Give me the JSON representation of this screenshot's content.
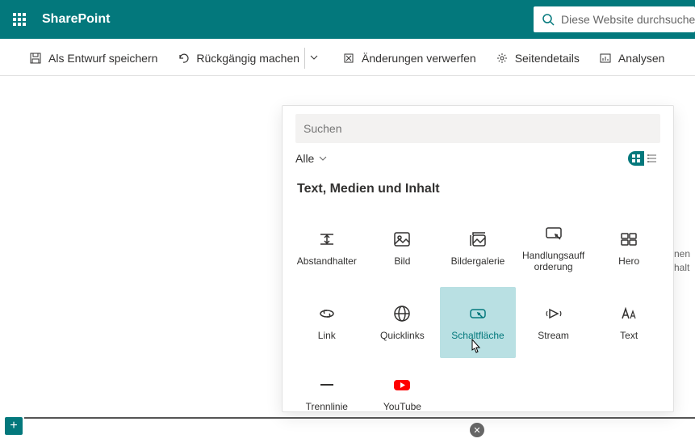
{
  "header": {
    "brand": "SharePoint",
    "search_placeholder": "Diese Website durchsuchen"
  },
  "commands": {
    "save_draft": "Als Entwurf speichern",
    "undo": "Rückgängig machen",
    "discard": "Änderungen verwerfen",
    "details": "Seitendetails",
    "analytics": "Analysen"
  },
  "panel": {
    "search_placeholder": "Suchen",
    "filter_label": "Alle",
    "section_title": "Text, Medien und Inhalt",
    "tiles": {
      "spacer": "Abstandhalter",
      "image": "Bild",
      "gallery": "Bildergalerie",
      "cta": "Handlungsauff\norderung",
      "hero": "Hero",
      "link": "Link",
      "quicklinks": "Quicklinks",
      "button": "Schaltfläche",
      "stream": "Stream",
      "text": "Text",
      "divider": "Trennlinie",
      "youtube": "YouTube"
    }
  },
  "bg_text": {
    "line1": "nen",
    "line2": "halt"
  }
}
